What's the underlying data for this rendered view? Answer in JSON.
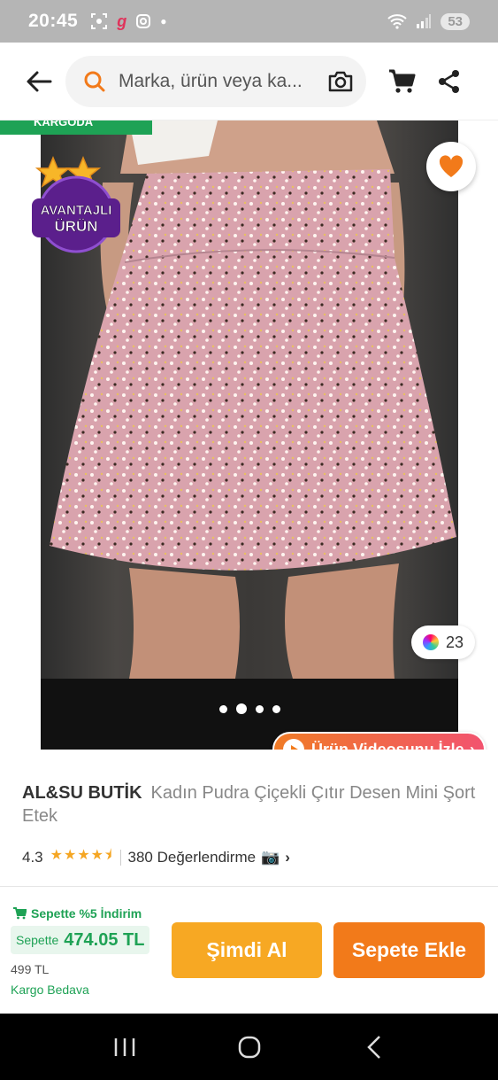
{
  "status_bar": {
    "time": "20:45",
    "battery": "53",
    "icons": [
      "screenshot-icon",
      "app-g-icon",
      "instagram-icon",
      "dot-icon",
      "wifi-icon",
      "signal-icon",
      "battery-icon"
    ]
  },
  "header": {
    "search_placeholder": "Marka, ürün veya ka...",
    "icons": [
      "back-arrow-icon",
      "search-icon",
      "camera-icon",
      "cart-icon",
      "share-icon"
    ]
  },
  "product_image": {
    "shipping_badge": "KARGODA",
    "advantage_badge": {
      "line1": "AVANTAJLI",
      "line2": "ÜRÜN"
    },
    "photo_count": "23",
    "carousel": {
      "total": 4,
      "active_index": 1
    },
    "video_button": "Ürün Videosunu İzle"
  },
  "product": {
    "brand": "AL&SU BUTİK",
    "name": "Kadın Pudra Çiçekli Çıtır Desen Mini Şort Etek",
    "rating": "4.3",
    "stars": "★★★★⯨",
    "reviews": "380 Değerlendirme",
    "reviews_icon": "📷",
    "chevron": "›"
  },
  "purchase": {
    "discount_note": "Sepette %5 İndirim",
    "price_label": "Sepette",
    "price": "474.05 TL",
    "old_price": "499 TL",
    "shipping": "Kargo Bedava",
    "buy_now": "Şimdi Al",
    "add_to_cart": "Sepete Ekle"
  },
  "colors": {
    "accent_orange": "#f27a1a",
    "buy_now_yellow": "#f7a823",
    "green": "#1ea255",
    "favorite_orange": "#f27a1a"
  },
  "nav": {
    "icons": [
      "recent-apps-icon",
      "home-icon",
      "back-icon"
    ]
  }
}
